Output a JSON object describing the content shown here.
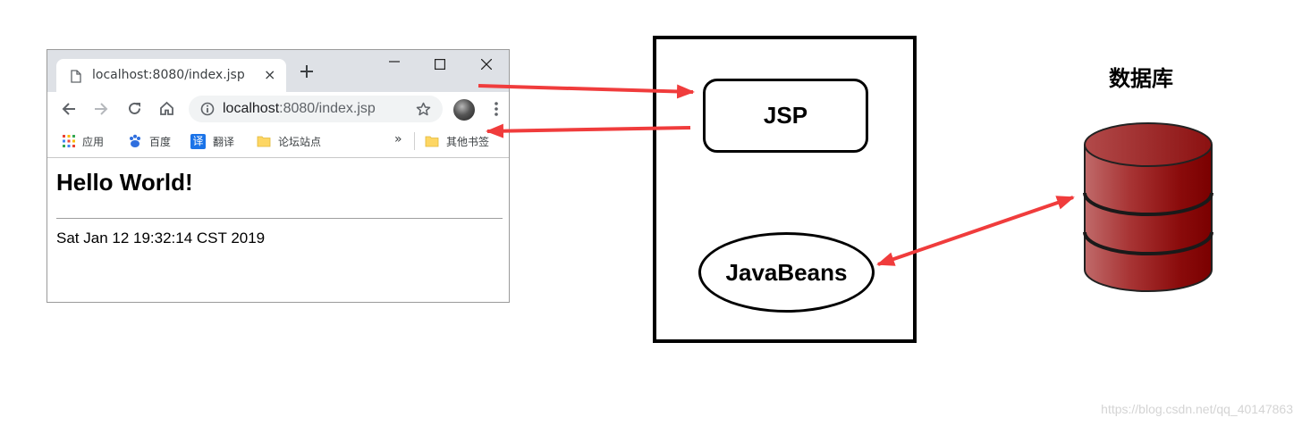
{
  "browser": {
    "tab_title": "localhost:8080/index.jsp",
    "tab_close": "×",
    "url_host": "localhost",
    "url_rest": ":8080/index.jsp",
    "bookmarks": [
      {
        "label": "应用",
        "icon": "apps-grid-icon"
      },
      {
        "label": "百度",
        "icon": "baidu-paw-icon"
      },
      {
        "label": "翻译",
        "icon": "translate-icon",
        "icon_text": "译"
      },
      {
        "label": "论坛站点",
        "icon": "folder-icon"
      }
    ],
    "bookmarks_more": "»",
    "other_bookmarks": "其他书签",
    "page": {
      "heading": "Hello World!",
      "date": "Sat Jan 12 19:32:14 CST 2019"
    }
  },
  "server": {
    "jsp_label": "JSP",
    "beans_label": "JavaBeans"
  },
  "database": {
    "title": "数据库",
    "color": "#8b0000"
  },
  "colors": {
    "arrow": "#f03c3c"
  },
  "watermark": "https://blog.csdn.net/qq_40147863"
}
